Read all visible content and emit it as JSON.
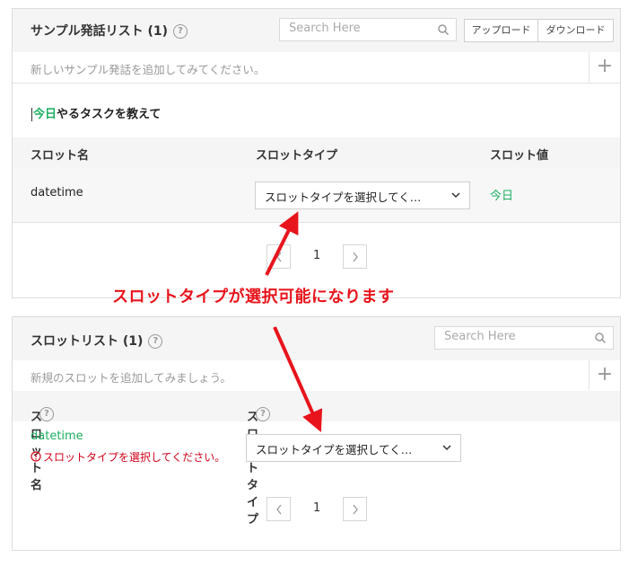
{
  "utterance_panel": {
    "title": "サンプル発話リスト (1)",
    "search_placeholder": "Search Here",
    "upload_label": "アップロード",
    "download_label": "ダウンロード",
    "add_placeholder": "新しいサンプル発話を追加してみてください。",
    "utterance_highlight": "今日",
    "utterance_rest": "やるタスクを教えて",
    "columns": {
      "slot_name": "スロット名",
      "slot_type": "スロットタイプ",
      "slot_value": "スロット値"
    },
    "row": {
      "slot_name": "datetime",
      "slot_type": "スロットタイプを選択してく…",
      "slot_value": "今日"
    },
    "page": "1"
  },
  "slot_panel": {
    "title": "スロットリスト (1)",
    "search_placeholder": "Search Here",
    "add_placeholder": "新規のスロットを追加してみましょう。",
    "columns": {
      "slot_name": "スロット名",
      "slot_type": "スロットタイプ"
    },
    "row": {
      "slot_name": "datetime",
      "error": "スロットタイプを選択してください。",
      "slot_type": "スロットタイプを選択してく…"
    },
    "page": "1"
  },
  "annotation": {
    "text": "スロットタイプが選択可能になります",
    "color": "#e8141c"
  },
  "colors": {
    "accent_green": "#1eae62",
    "error_red": "#d0021b"
  }
}
